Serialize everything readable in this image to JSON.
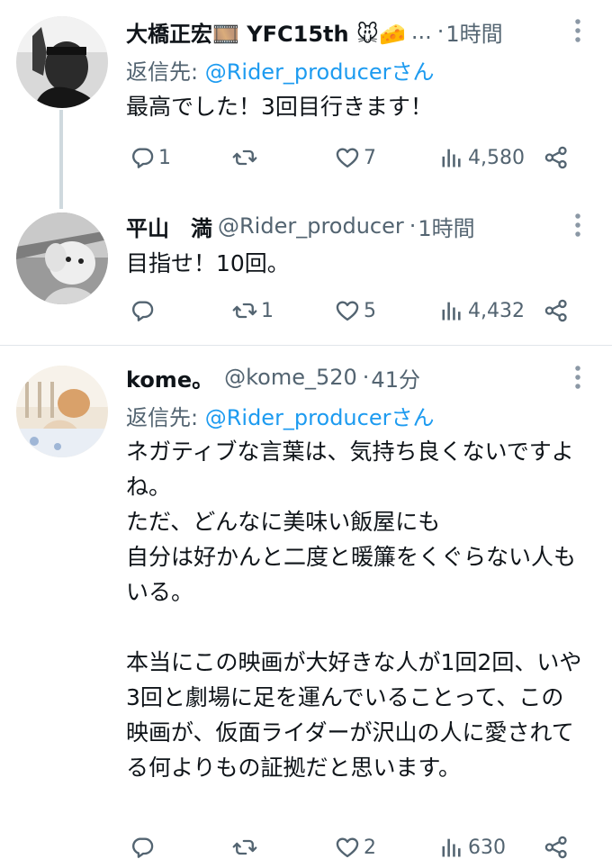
{
  "tweets": [
    {
      "name": "大橋正宏🎞️ YFC15th 🐭🧀",
      "handle": "",
      "ellipsis": "...",
      "time": "1時間",
      "reply_prefix": "返信先: ",
      "reply_mention": "@Rider_producer",
      "reply_suffix": "さん",
      "text": "最高でした！3回目行きます！",
      "replies": "1",
      "retweets": "",
      "likes": "7",
      "views": "4,580"
    },
    {
      "name": "平山　満",
      "handle": "@Rider_producer",
      "time": "1時間",
      "text": "目指せ！10回。",
      "replies": "",
      "retweets": "1",
      "likes": "5",
      "views": "4,432"
    },
    {
      "name": "kome。",
      "handle": "@kome_520",
      "time": "41分",
      "reply_prefix": "返信先: ",
      "reply_mention": "@Rider_producer",
      "reply_suffix": "さん",
      "text": "ネガティブな言葉は、気持ち良くないですよね。\nただ、どんなに美味い飯屋にも\n自分は好かんと二度と暖簾をくぐらない人もいる。\n\n本当にこの映画が大好きな人が1回2回、いや3回と劇場に足を運んでいることって、この映画が、仮面ライダーが沢山の人に愛されてる何よりもの証拠だと思います。",
      "replies": "",
      "retweets": "",
      "likes": "2",
      "views": "630"
    }
  ],
  "colors": {
    "text": "#0f1419",
    "secondary": "#536471",
    "link": "#1d9bf0",
    "thread_line": "#cfd9de"
  },
  "icons": [
    "reply-icon",
    "retweet-icon",
    "like-icon",
    "views-icon",
    "share-icon",
    "more-icon"
  ]
}
